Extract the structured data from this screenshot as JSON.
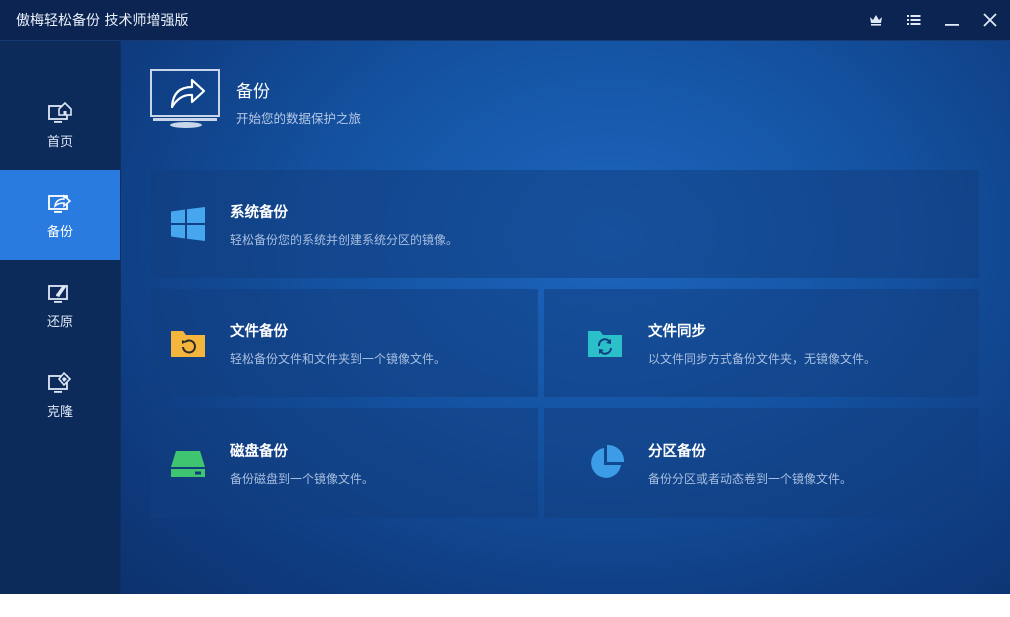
{
  "window": {
    "title": "傲梅轻松备份 技术师增强版"
  },
  "titlebar_buttons": [
    "crown-icon",
    "menu-list-icon",
    "minimize-icon",
    "close-icon"
  ],
  "sidebar": {
    "items": [
      {
        "label": "首页",
        "icon": "home-monitor-icon",
        "active": false
      },
      {
        "label": "备份",
        "icon": "backup-monitor-icon",
        "active": true
      },
      {
        "label": "还原",
        "icon": "restore-monitor-icon",
        "active": false
      },
      {
        "label": "克隆",
        "icon": "clone-monitor-icon",
        "active": false
      }
    ]
  },
  "header": {
    "title": "备份",
    "subtitle": "开始您的数据保护之旅"
  },
  "cards": {
    "system": {
      "title": "系统备份",
      "desc": "轻松备份您的系统并创建系统分区的镜像。",
      "icon": "windows-logo-icon"
    },
    "file": {
      "title": "文件备份",
      "desc": "轻松备份文件和文件夹到一个镜像文件。",
      "icon": "folder-backup-icon"
    },
    "sync": {
      "title": "文件同步",
      "desc": "以文件同步方式备份文件夹，无镜像文件。",
      "icon": "folder-sync-icon"
    },
    "disk": {
      "title": "磁盘备份",
      "desc": "备份磁盘到一个镜像文件。",
      "icon": "disk-icon"
    },
    "partition": {
      "title": "分区备份",
      "desc": "备份分区或者动态卷到一个镜像文件。",
      "icon": "pie-partition-icon"
    }
  },
  "colors": {
    "sidebar_active": "#2a7be0",
    "folder_yellow": "#f3b53c",
    "sync_teal": "#2bbfc9",
    "disk_green": "#3fc56f",
    "partition_blue": "#3c9ce8",
    "windows_blue": "#46a6ee"
  }
}
